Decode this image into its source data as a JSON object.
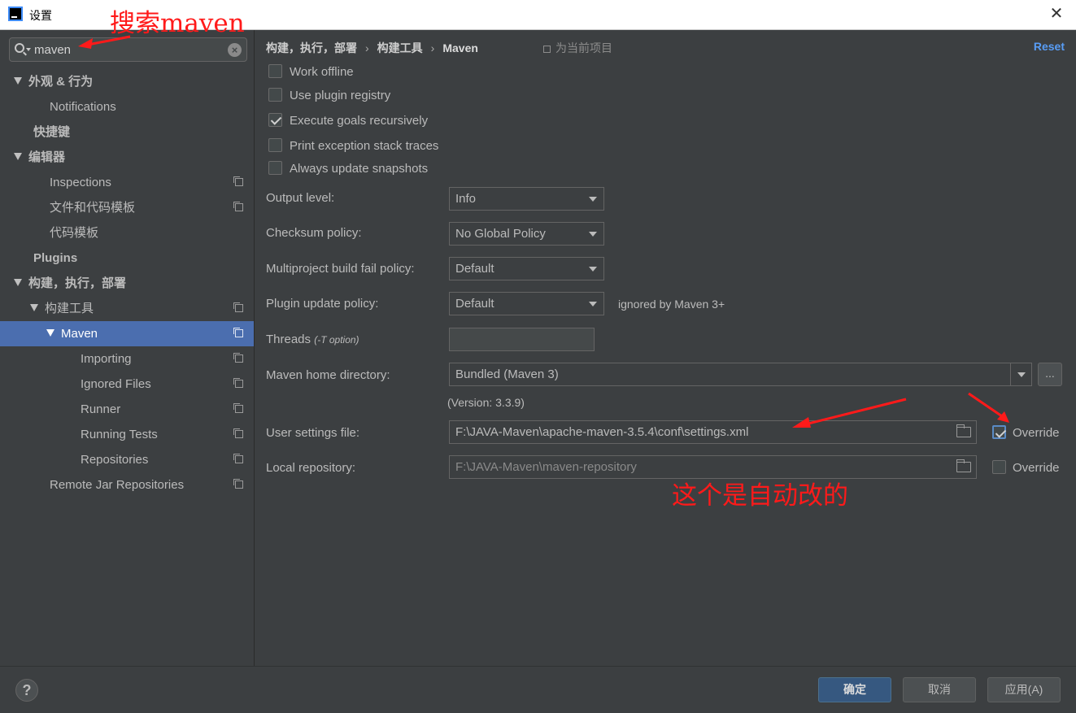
{
  "window": {
    "title": "设置"
  },
  "search": {
    "value": "maven"
  },
  "tree": [
    {
      "label": "外观 & 行为",
      "name": "tree-appearance",
      "indent": 0,
      "arrow": true,
      "bold": true,
      "icon": false
    },
    {
      "label": "Notifications",
      "name": "tree-notifications",
      "indent": 1,
      "arrow": false,
      "bold": false,
      "icon": false
    },
    {
      "label": "快捷键",
      "name": "tree-keymap",
      "indent": 0,
      "arrow": false,
      "bold": true,
      "icon": false
    },
    {
      "label": "编辑器",
      "name": "tree-editor",
      "indent": 0,
      "arrow": true,
      "bold": true,
      "icon": false
    },
    {
      "label": "Inspections",
      "name": "tree-inspections",
      "indent": 1,
      "arrow": false,
      "bold": false,
      "icon": true
    },
    {
      "label": "文件和代码模板",
      "name": "tree-file-code-templates",
      "indent": 1,
      "arrow": false,
      "bold": false,
      "icon": true
    },
    {
      "label": "代码模板",
      "name": "tree-live-templates",
      "indent": 1,
      "arrow": false,
      "bold": false,
      "icon": false
    },
    {
      "label": "Plugins",
      "name": "tree-plugins",
      "indent": 0,
      "arrow": false,
      "bold": true,
      "icon": false
    },
    {
      "label": "构建，执行，部署",
      "name": "tree-build-exec-deploy",
      "indent": 0,
      "arrow": true,
      "bold": true,
      "icon": false
    },
    {
      "label": "构建工具",
      "name": "tree-build-tools",
      "indent": 1,
      "arrow": true,
      "bold": false,
      "icon": true
    },
    {
      "label": "Maven",
      "name": "tree-maven",
      "indent": 2,
      "arrow": true,
      "bold": false,
      "icon": true,
      "selected": true
    },
    {
      "label": "Importing",
      "name": "tree-importing",
      "indent": 3,
      "arrow": false,
      "bold": false,
      "icon": true
    },
    {
      "label": "Ignored Files",
      "name": "tree-ignored-files",
      "indent": 3,
      "arrow": false,
      "bold": false,
      "icon": true
    },
    {
      "label": "Runner",
      "name": "tree-runner",
      "indent": 3,
      "arrow": false,
      "bold": false,
      "icon": true
    },
    {
      "label": "Running Tests",
      "name": "tree-running-tests",
      "indent": 3,
      "arrow": false,
      "bold": false,
      "icon": true
    },
    {
      "label": "Repositories",
      "name": "tree-repositories",
      "indent": 3,
      "arrow": false,
      "bold": false,
      "icon": true
    },
    {
      "label": "Remote Jar Repositories",
      "name": "tree-remote-jar-repos",
      "indent": 1,
      "arrow": false,
      "bold": false,
      "icon": true
    }
  ],
  "breadcrumb": {
    "part1": "构建，执行，部署",
    "part2": "构建工具",
    "part3": "Maven",
    "sep": "›"
  },
  "for_project": "为当前项目",
  "reset_label": "Reset",
  "checkboxes": [
    {
      "label": "Work offline",
      "checked": false
    },
    {
      "label": "Use plugin registry",
      "checked": false
    },
    {
      "label": "Execute goals recursively",
      "checked": true
    },
    {
      "label": "Print exception stack traces",
      "checked": false
    },
    {
      "label": "Always update snapshots",
      "checked": false
    }
  ],
  "fields": {
    "output_level": {
      "label": "Output level:",
      "value": "Info"
    },
    "checksum_policy": {
      "label": "Checksum policy:",
      "value": "No Global Policy"
    },
    "multiproject_policy": {
      "label": "Multiproject build fail policy:",
      "value": "Default"
    },
    "plugin_update_policy": {
      "label": "Plugin update policy:",
      "value": "Default",
      "note": "ignored by Maven 3+"
    },
    "threads": {
      "label": "Threads",
      "hint": "(-T option)",
      "value": ""
    },
    "maven_home": {
      "label": "Maven home directory:",
      "value": "Bundled (Maven 3)",
      "browse": "...",
      "version": "(Version: 3.3.9)"
    },
    "user_settings": {
      "label": "User settings file:",
      "value": "F:\\JAVA-Maven\\apache-maven-3.5.4\\conf\\settings.xml",
      "override_label": "Override",
      "override_checked": true
    },
    "local_repo": {
      "label": "Local repository:",
      "value": "F:\\JAVA-Maven\\maven-repository",
      "override_label": "Override",
      "override_checked": false
    }
  },
  "footer": {
    "help": "?",
    "ok": "确定",
    "cancel": "取消",
    "apply": "应用(A)"
  },
  "annotations": {
    "search_note": "搜索maven",
    "auto_note": "这个是自动改的",
    "color": "#ff1a1a"
  }
}
